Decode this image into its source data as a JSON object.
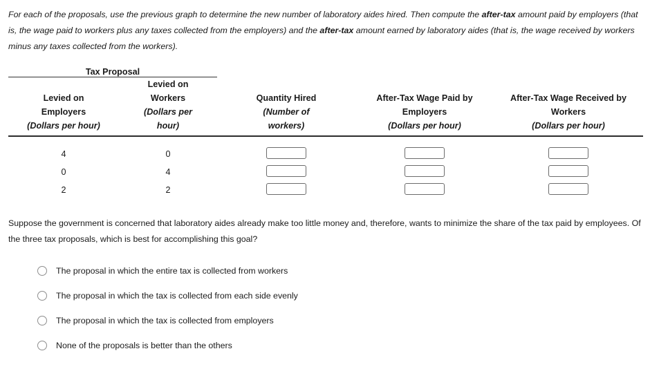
{
  "intro": {
    "line1_a": "For each of the proposals, use the previous graph to determine the new number of laboratory aides hired. Then compute the ",
    "line1_b": "after-tax",
    "line1_c": " amount paid by employers (that is, the wage paid to workers plus any taxes collected from the employers) and the ",
    "line1_d": "after-tax",
    "line1_e": " amount earned by laboratory aides (that is, the wage received by workers minus any taxes collected from the workers)."
  },
  "table": {
    "group_header": "Tax Proposal",
    "headers": {
      "levied_employers": "Levied on\nEmployers",
      "levied_employers_l1": "Levied on",
      "levied_employers_l2": "Employers",
      "levied_employers_units": "(Dollars per hour)",
      "levied_workers_l1": "Levied on",
      "levied_workers_l2": "Workers",
      "levied_workers_units_l1": "(Dollars per",
      "levied_workers_units_l2": "hour)",
      "quantity_hired": "Quantity Hired",
      "quantity_hired_units_l1": "(Number of",
      "quantity_hired_units_l2": "workers)",
      "after_tax_paid_l1": "After-Tax Wage Paid by",
      "after_tax_paid_l2": "Employers",
      "after_tax_paid_units": "(Dollars per hour)",
      "after_tax_received_l1": "After-Tax Wage Received by",
      "after_tax_received_l2": "Workers",
      "after_tax_received_units": "(Dollars per hour)"
    },
    "rows": [
      {
        "levied_employers": "4",
        "levied_workers": "0",
        "quantity_hired": "",
        "after_tax_paid": "",
        "after_tax_received": ""
      },
      {
        "levied_employers": "0",
        "levied_workers": "4",
        "quantity_hired": "",
        "after_tax_paid": "",
        "after_tax_received": ""
      },
      {
        "levied_employers": "2",
        "levied_workers": "2",
        "quantity_hired": "",
        "after_tax_paid": "",
        "after_tax_received": ""
      }
    ]
  },
  "question": {
    "text": "Suppose the government is concerned that laboratory aides already make too little money and, therefore, wants to minimize the share of the tax paid by employees. Of the three tax proposals, which is best for accomplishing this goal?",
    "options": [
      "The proposal in which the entire tax is collected from workers",
      "The proposal in which the tax is collected from each side evenly",
      "The proposal in which the tax is collected from employers",
      "None of the proposals is better than the others"
    ]
  }
}
